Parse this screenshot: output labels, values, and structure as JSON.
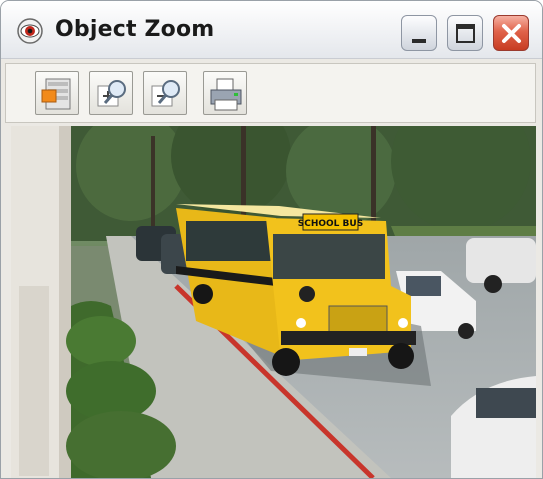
{
  "window": {
    "title": "Object Zoom",
    "controls": [
      "minimize",
      "maximize",
      "close"
    ]
  },
  "toolbar": {
    "buttons": [
      {
        "name": "select-object-button",
        "icon": "select-object-icon"
      },
      {
        "name": "zoom-in-button",
        "icon": "zoom-in-icon"
      },
      {
        "name": "zoom-out-button",
        "icon": "zoom-out-icon"
      },
      {
        "name": "print-button",
        "icon": "printer-icon"
      }
    ]
  },
  "image": {
    "subject": "school bus in parking lot",
    "bus_sign_text": "SCHOOL BUS"
  },
  "colors": {
    "close_button": "#e0634a",
    "bus_yellow": "#f2c21c",
    "curb_red": "#c8352b",
    "titlebar": "#f3f4f6"
  }
}
